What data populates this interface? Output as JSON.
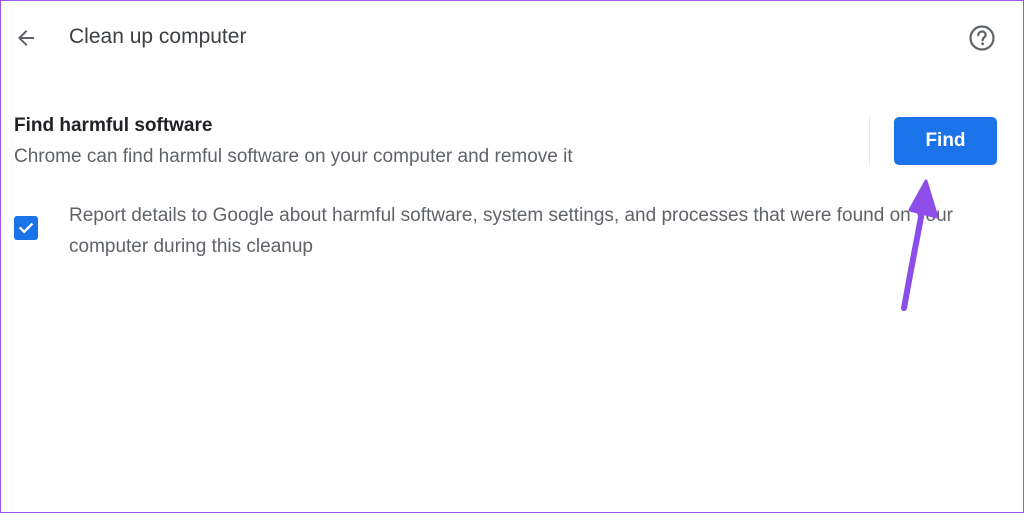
{
  "header": {
    "title": "Clean up computer",
    "back_icon": "arrow-left-icon",
    "help_icon": "help-circle-icon"
  },
  "section": {
    "title": "Find harmful software",
    "description": "Chrome can find harmful software on your computer and remove it",
    "find_button_label": "Find"
  },
  "report": {
    "checked": true,
    "text": "Report details to Google about harmful software, system settings, and processes that were found on your computer during this cleanup"
  },
  "colors": {
    "accent": "#1a73e8",
    "annotation_arrow": "#8c4de8",
    "frame_border": "#9b59e6"
  }
}
